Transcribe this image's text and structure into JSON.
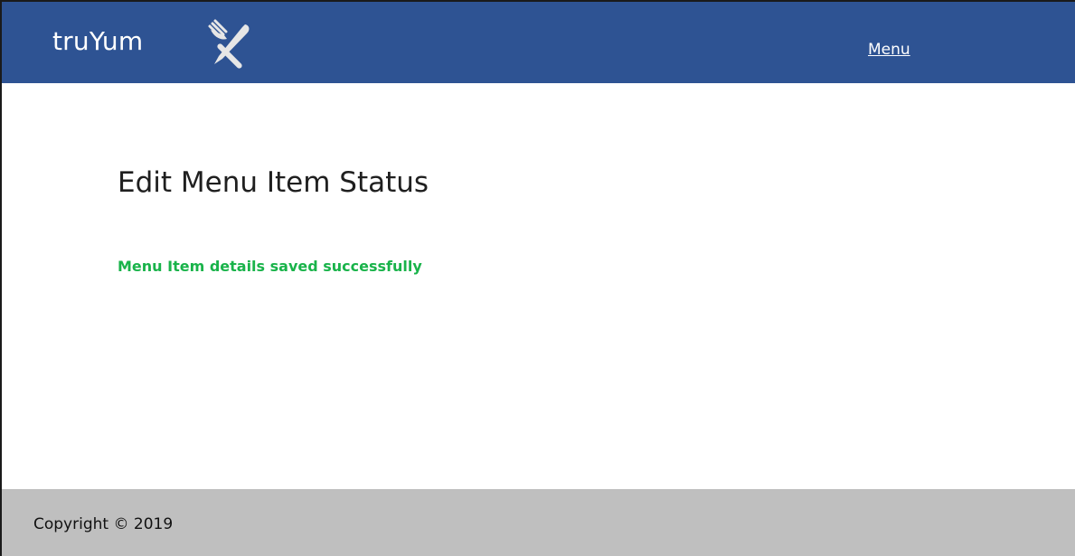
{
  "header": {
    "brand": "truYum",
    "brand_icon": "fork-and-knife-icon",
    "nav_menu_label": "Menu",
    "background_color": "#2e5393"
  },
  "main": {
    "title": "Edit Menu Item Status",
    "status_message": "Menu Item details saved successfully",
    "status_color": "#19b34a"
  },
  "footer": {
    "copyright": "Copyright © 2019",
    "background_color": "#bfbfbf"
  }
}
